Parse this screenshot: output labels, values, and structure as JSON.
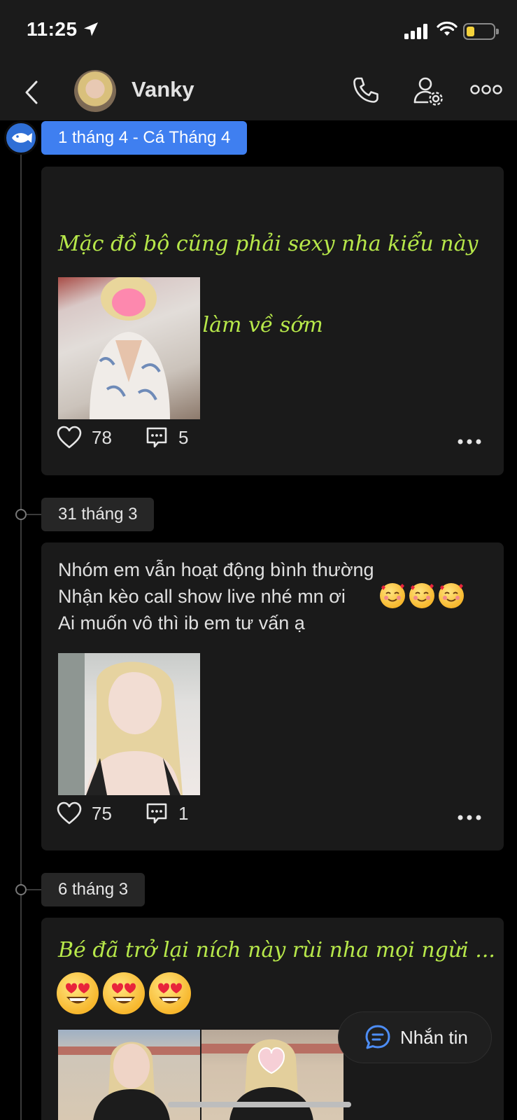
{
  "status_bar": {
    "time": "11:25",
    "location_icon": "location-arrow-icon",
    "battery_color": "#f4d23b"
  },
  "header": {
    "back_icon": "chevron-left-icon",
    "contact_name": "Vanky",
    "call_icon": "phone-icon",
    "settings_icon": "user-settings-icon",
    "more_icon": "more-icon"
  },
  "colors": {
    "accent": "#3f7ff0",
    "script_text": "#b7e84a",
    "card": "#1a1a1a"
  },
  "posts": [
    {
      "date": "1 tháng 4 - Cá Tháng 4",
      "text_line1": "Mặc đồ bộ cũng phải sexy nha kiểu này",
      "text_line2": "chồng mới đi làm về sớm",
      "emoji": "😂",
      "likes": "78",
      "comments": "5"
    },
    {
      "date": "31 tháng 3",
      "text": "Nhóm em vẫn hoạt động bình thường\nNhận kèo call show live nhé mn ơi\nAi muốn vô thì ib em tư vấn ạ",
      "emoji": "🥰",
      "likes": "75",
      "comments": "1"
    },
    {
      "date": "6 tháng 3",
      "text_line1": "Bé đã trở lại ních này rùi nha mọi ngừi ...",
      "emoji": "😍"
    }
  ],
  "message_button": {
    "label": "Nhắn tin",
    "icon": "chat-bubble-icon"
  }
}
